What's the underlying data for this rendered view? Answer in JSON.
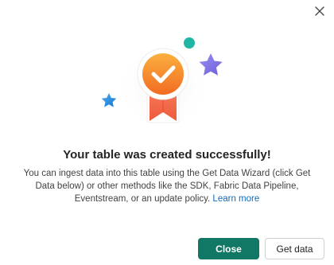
{
  "dialog": {
    "title": "Your table was created successfully!",
    "body": "You can ingest data into this table using the Get Data Wizard (click Get Data below) or other methods like the SDK, Fabric Data Pipeline, Eventstream, or an update policy.",
    "learn_more_label": "Learn more",
    "close_button_label": "Close",
    "get_data_button_label": "Get data"
  },
  "icons": {
    "close": "close-icon",
    "badge": "award-ribbon-icon"
  },
  "colors": {
    "primary": "#117865",
    "link": "#0f6cbd",
    "badge_orange": "#f7941d",
    "star_purple": "#7f74e8",
    "star_blue": "#2d8fe0",
    "dot_teal": "#1fb6a4"
  }
}
